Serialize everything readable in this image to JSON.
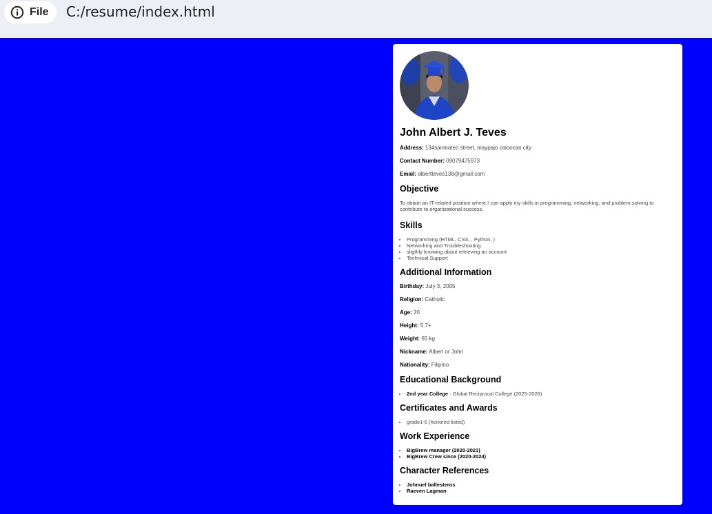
{
  "browser": {
    "site_label": "File",
    "url": "C:/resume/index.html",
    "info_icon": "info-icon"
  },
  "resume": {
    "name": "John Albert J. Teves",
    "contact": [
      {
        "label": "Address:",
        "value": "134sanmateo street, maypajo caloocan city"
      },
      {
        "label": "Contact Number:",
        "value": "09079475973"
      },
      {
        "label": "Email:",
        "value": "albertteves138@gmail.com"
      }
    ],
    "objective": {
      "heading": "Objective",
      "text": "To obtain an IT-related position where I can apply my skills in programming, networking, and problem-solving to contribute to organizational success."
    },
    "skills": {
      "heading": "Skills",
      "items": [
        "Programming (HTML, CSS, , Python, )",
        "Networking and Troubleshooting",
        "sligthly knowing about retrieving an account",
        "Technical Support"
      ]
    },
    "additional": {
      "heading": "Additional Information",
      "items": [
        {
          "label": "Birthday:",
          "value": "July 3, 2005"
        },
        {
          "label": "Religion:",
          "value": "Catholic"
        },
        {
          "label": "Age:",
          "value": "20"
        },
        {
          "label": "Height:",
          "value": "5.7+"
        },
        {
          "label": "Weight:",
          "value": "65 kg"
        },
        {
          "label": "Nickname:",
          "value": "Albert or John"
        },
        {
          "label": "Nationality:",
          "value": "Filipino"
        }
      ]
    },
    "education": {
      "heading": "Educational Background",
      "items": [
        {
          "bold": "2nd year College",
          "rest": " - Global Reciprocal College (2025-2026)"
        }
      ]
    },
    "certificates": {
      "heading": "Certificates and Awards",
      "items": [
        "grade1-6 (honored listed)"
      ]
    },
    "work": {
      "heading": "Work Experience",
      "items": [
        "BigBrew manager (2020-2021)",
        "BigBrew Crew since (2020-2024)"
      ]
    },
    "references": {
      "heading": "Character References",
      "items": [
        "Johnuel ballesteros",
        "Raeven Lagman"
      ]
    }
  },
  "colors": {
    "page_background": "#0000ff",
    "card_background": "#ffffff"
  }
}
